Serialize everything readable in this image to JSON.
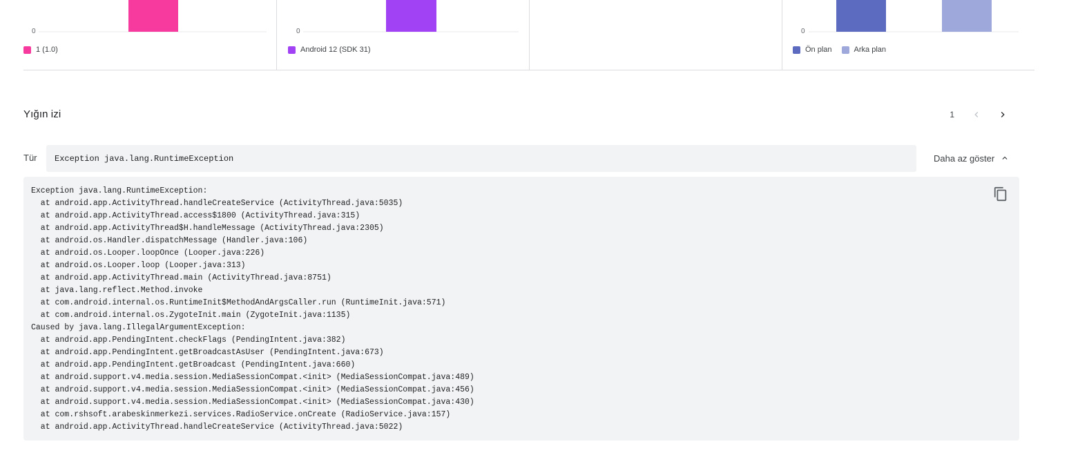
{
  "colors": {
    "pink": "#f63a9e",
    "purple": "#a142f4",
    "indigo": "#5c6bc0",
    "lavender": "#9fa8da"
  },
  "charts": {
    "version": {
      "axis_zero": "0",
      "legend": [
        {
          "label": "1 (1.0)",
          "color": "#f63a9e"
        }
      ]
    },
    "os": {
      "axis_zero": "0",
      "legend": [
        {
          "label": "Android 12 (SDK 31)",
          "color": "#a142f4"
        }
      ]
    },
    "state": {
      "axis_zero": "0",
      "legend": [
        {
          "label": "Ön plan",
          "color": "#5c6bc0"
        },
        {
          "label": "Arka plan",
          "color": "#9fa8da"
        }
      ]
    }
  },
  "stack": {
    "title": "Yığın izi",
    "page": "1",
    "prev_icon": "chevron-left-icon",
    "next_icon": "chevron-right-icon",
    "type_label": "Tür",
    "type_value": "Exception java.lang.RuntimeException",
    "toggle_label": "Daha az göster",
    "copy_icon": "copy-icon",
    "trace": "Exception java.lang.RuntimeException:\n  at android.app.ActivityThread.handleCreateService (ActivityThread.java:5035)\n  at android.app.ActivityThread.access$1800 (ActivityThread.java:315)\n  at android.app.ActivityThread$H.handleMessage (ActivityThread.java:2305)\n  at android.os.Handler.dispatchMessage (Handler.java:106)\n  at android.os.Looper.loopOnce (Looper.java:226)\n  at android.os.Looper.loop (Looper.java:313)\n  at android.app.ActivityThread.main (ActivityThread.java:8751)\n  at java.lang.reflect.Method.invoke\n  at com.android.internal.os.RuntimeInit$MethodAndArgsCaller.run (RuntimeInit.java:571)\n  at com.android.internal.os.ZygoteInit.main (ZygoteInit.java:1135)\nCaused by java.lang.IllegalArgumentException:\n  at android.app.PendingIntent.checkFlags (PendingIntent.java:382)\n  at android.app.PendingIntent.getBroadcastAsUser (PendingIntent.java:673)\n  at android.app.PendingIntent.getBroadcast (PendingIntent.java:660)\n  at android.support.v4.media.session.MediaSessionCompat.<init> (MediaSessionCompat.java:489)\n  at android.support.v4.media.session.MediaSessionCompat.<init> (MediaSessionCompat.java:456)\n  at android.support.v4.media.session.MediaSessionCompat.<init> (MediaSessionCompat.java:430)\n  at com.rshsoft.arabeskinmerkezi.services.RadioService.onCreate (RadioService.java:157)\n  at android.app.ActivityThread.handleCreateService (ActivityThread.java:5022)"
  }
}
